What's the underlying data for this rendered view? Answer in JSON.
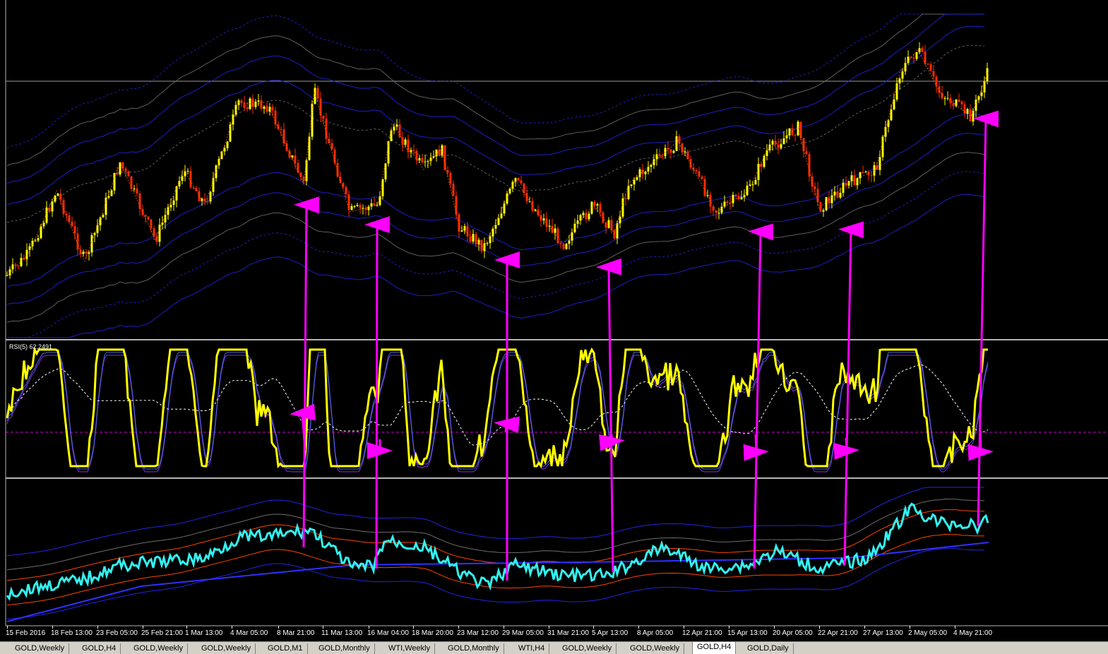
{
  "window": {
    "symbol": "GOLD",
    "timeframe": "H4"
  },
  "indicator": {
    "rsi_label": "RSI(5) 62.2491"
  },
  "x_axis": {
    "labels": [
      "15 Feb 2016",
      "18 Feb 13:00",
      "23 Feb 05:00",
      "25 Feb 21:00",
      "1 Mar 13:00",
      "4 Mar 05:00",
      "8 Mar 21:00",
      "11 Mar 13:00",
      "16 Mar 04:00",
      "18 Mar 20:00",
      "23 Mar 12:00",
      "29 Mar 05:00",
      "31 Mar 21:00",
      "5 Apr 13:00",
      "8 Apr 05:00",
      "12 Apr 21:00",
      "15 Apr 13:00",
      "20 Apr 05:00",
      "22 Apr 21:00",
      "27 Apr 13:00",
      "2 May 05:00",
      "4 May 21:00"
    ]
  },
  "tabs": [
    {
      "label": "GOLD,Weekly",
      "active": false
    },
    {
      "label": "GOLD,H4",
      "active": false
    },
    {
      "label": "GOLD,Weekly",
      "active": false
    },
    {
      "label": "GOLD,Weekly",
      "active": false
    },
    {
      "label": "GOLD,M1",
      "active": false
    },
    {
      "label": "GOLD,Monthly",
      "active": false
    },
    {
      "label": "WTI,Weekly",
      "active": false
    },
    {
      "label": "GOLD,Monthly",
      "active": false
    },
    {
      "label": "WTI,H4",
      "active": false
    },
    {
      "label": "GOLD,Weekly",
      "active": false
    },
    {
      "label": "GOLD,Weekly",
      "active": false
    },
    {
      "label": "GOLD,H4",
      "active": true
    },
    {
      "label": "GOLD,Daily",
      "active": false
    }
  ],
  "colors": {
    "background": "#000000",
    "candle_up": "#ffff00",
    "candle_down": "#ff2a00",
    "rsi_line": "#ffff00",
    "lower_line": "#33f0f0",
    "arrow": "#ff00ff",
    "band_blue": "#2323e6",
    "band_gray": "#6e6e6e",
    "separator": "#b4b4b4"
  },
  "icons": [
    "divergence-arrow"
  ]
}
